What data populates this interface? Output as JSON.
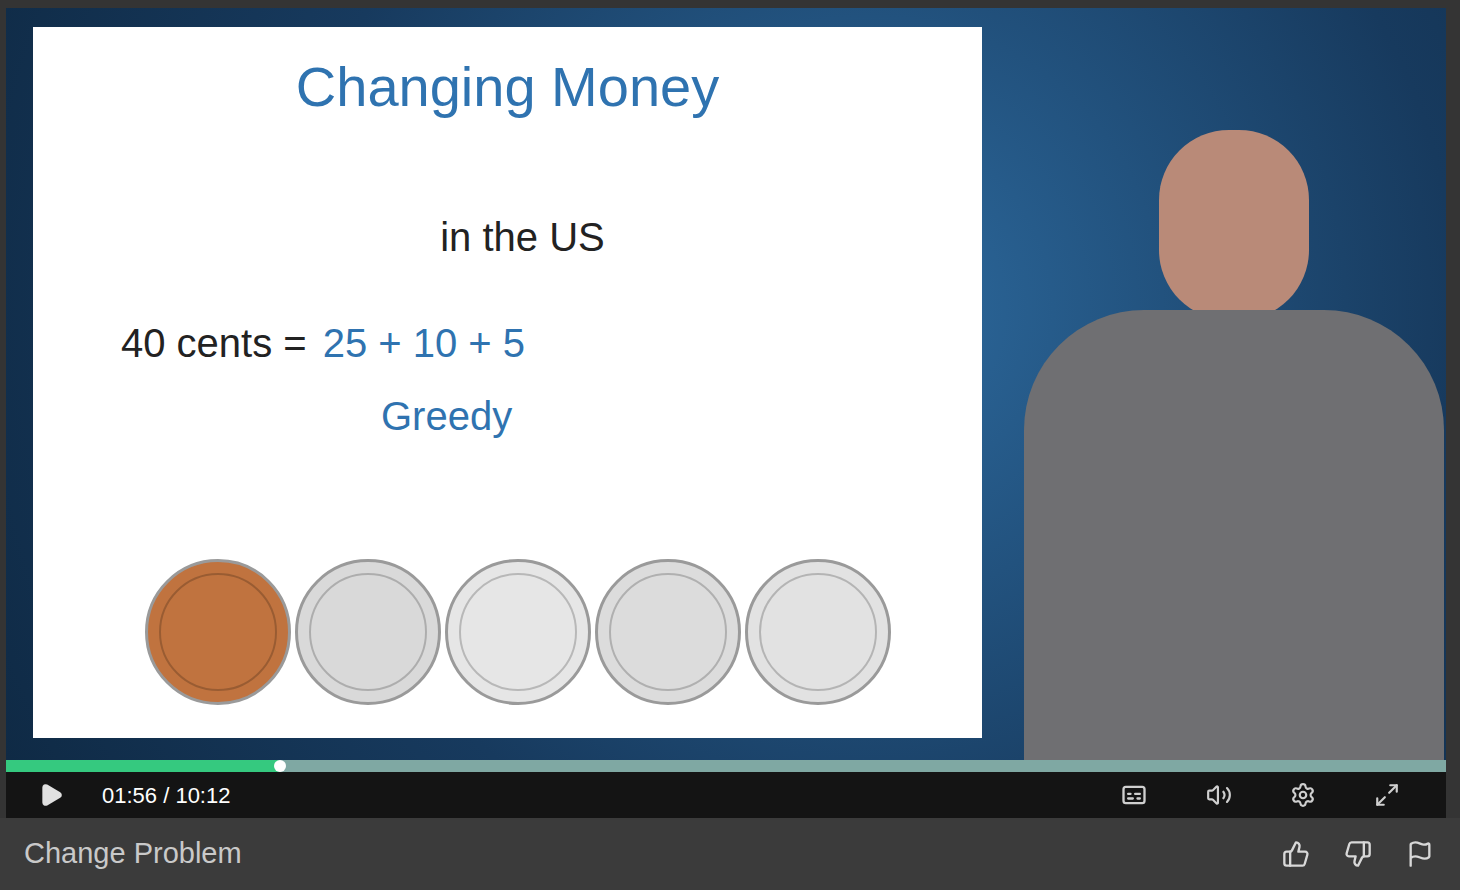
{
  "video": {
    "slide": {
      "title": "Changing Money",
      "subtitle": "in the US",
      "equation_left": "40 cents =",
      "equation_right": "25 + 10 + 5",
      "caption": "Greedy",
      "coins": [
        {
          "color": "#c0733f"
        },
        {
          "color": "#d9d9d9"
        },
        {
          "color": "#e6e6e6"
        },
        {
          "color": "#dcdcdc"
        },
        {
          "color": "#e2e2e2"
        }
      ]
    },
    "progress": {
      "level": 0.19
    },
    "controls": {
      "playing": false,
      "time": "01:56 / 10:12"
    }
  },
  "lecture": {
    "title": "Change Problem"
  }
}
